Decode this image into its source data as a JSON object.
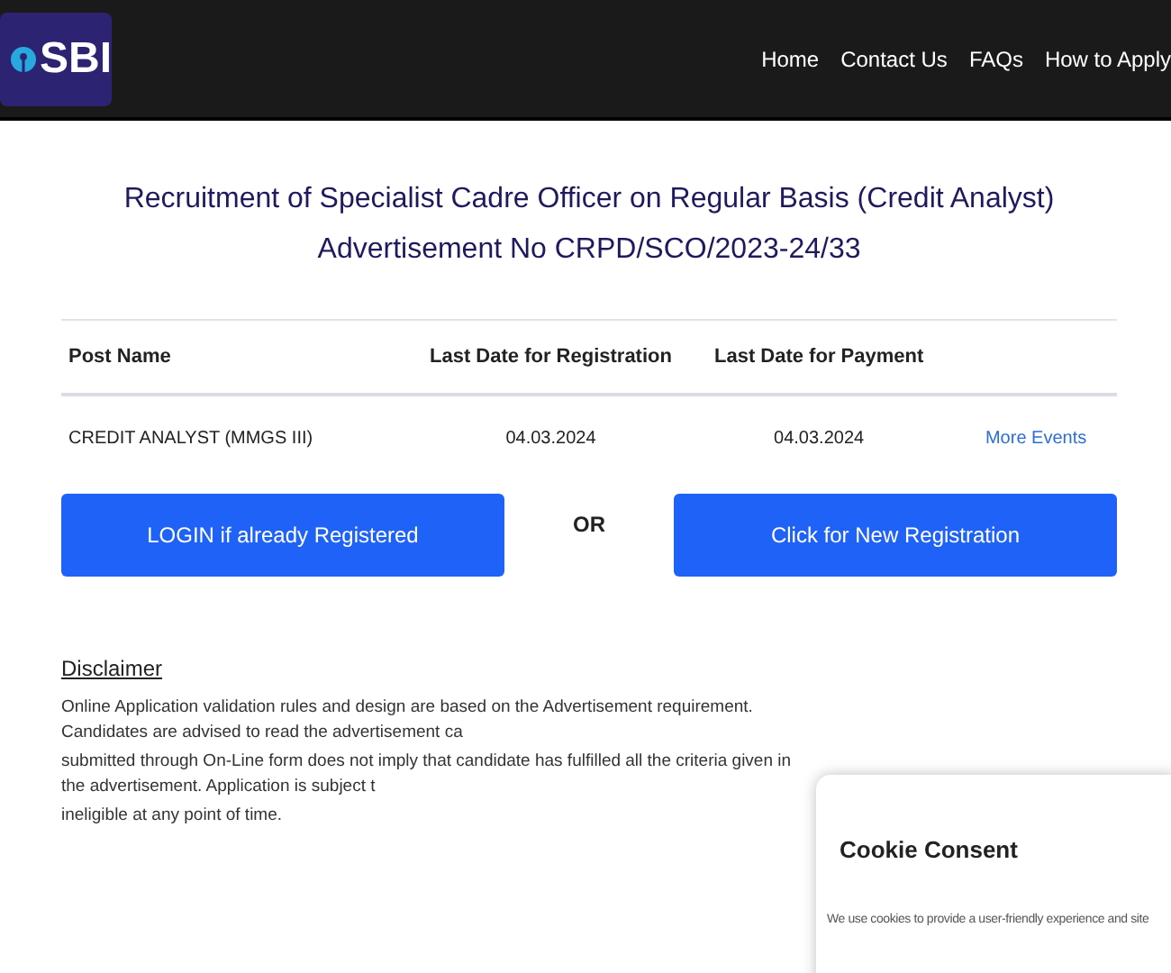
{
  "header": {
    "logo_text": "SBI",
    "nav": [
      "Home",
      "Contact Us",
      "FAQs",
      "How to Apply"
    ]
  },
  "title": [
    "Recruitment of Specialist Cadre Officer on Regular Basis (Credit Analyst)",
    "Advertisement No CRPD/SCO/2023-24/33"
  ],
  "table": {
    "columns": [
      "Post Name",
      "Last Date for Registration",
      "Last Date for Payment"
    ],
    "rows": [
      {
        "post": "CREDIT ANALYST (MMGS III)",
        "registration": "04.03.2024",
        "payment": "04.03.2024",
        "link": "More Events"
      }
    ]
  },
  "buttons": {
    "login": "LOGIN if already Registered",
    "or": "OR",
    "register": "Click for New Registration"
  },
  "disclaimer": {
    "heading": "Disclaimer",
    "lines": [
      "Online Application validation rules and design are based on the Advertisement requirement. Candidates are advised to read the advertisement ca",
      "submitted through On-Line form does not imply that candidate has fulfilled all the criteria given in the advertisement. Application is subject t",
      "ineligible at any point of time."
    ]
  },
  "cookie": {
    "title": "Cookie Consent",
    "text": "We use cookies to provide a user-friendly experience and site"
  }
}
